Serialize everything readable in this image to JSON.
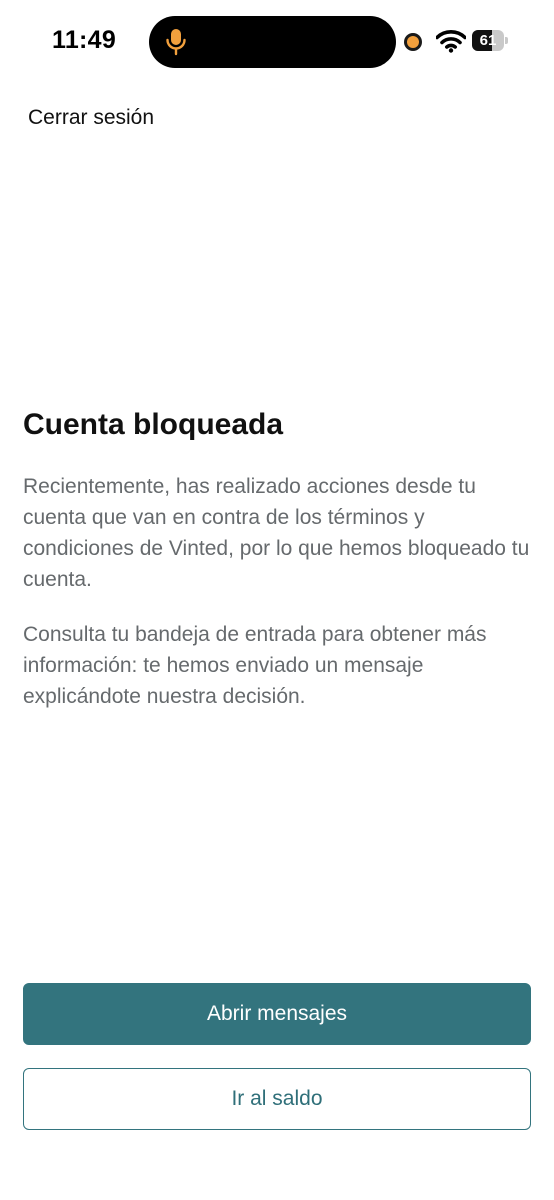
{
  "status_bar": {
    "time": "11:49",
    "battery_level": "61",
    "battery_fraction": 0.61,
    "recording_dot_color": "#f2a03d",
    "icons": [
      "microphone-icon",
      "wifi-icon",
      "battery-icon"
    ]
  },
  "header": {
    "logout_label": "Cerrar sesión"
  },
  "content": {
    "title": "Cuenta bloqueada",
    "paragraph_1": "Recientemente, has realizado acciones desde tu cuenta que van en contra de los términos y condiciones de Vinted, por lo que hemos bloqueado tu cuenta.",
    "paragraph_2": "Consulta tu bandeja de entrada para obtener más información: te hemos enviado un mensaje explicándote nuestra decisión."
  },
  "actions": {
    "primary_label": "Abrir mensajes",
    "secondary_label": "Ir al saldo"
  },
  "colors": {
    "accent": "#33747e",
    "body_text": "#666a6d",
    "title_text": "#111111"
  }
}
